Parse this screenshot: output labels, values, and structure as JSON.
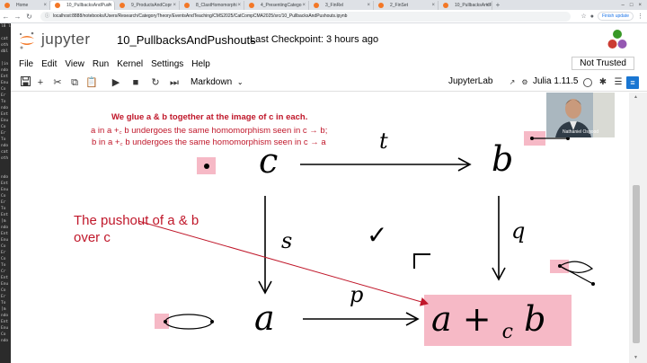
{
  "browser": {
    "tabs": [
      {
        "label": "Home",
        "active": false
      },
      {
        "label": "10_PullbacksAndPush",
        "active": true
      },
      {
        "label": "9_ProductsAndCopr",
        "active": false
      },
      {
        "label": "8_ClastHomomorphi",
        "active": false
      },
      {
        "label": "4_PresentingCatego",
        "active": false
      },
      {
        "label": "3_FinRel",
        "active": false
      },
      {
        "label": "2_FinSet",
        "active": false
      },
      {
        "label": "10_PullbacksAndPus",
        "active": false
      }
    ],
    "url": "localhost:8888/notebooks/Users/Research/CategoryTheory/EventsAndTeaching/CMS2025/CatCompCMA2025/src/10_PullbacksAndPushouts.ipynb",
    "update_label": "Finish update"
  },
  "terminal_lines": [
    "l8 l",
    "",
    "cat",
    "oth",
    "dbl",
    "",
    "[in",
    "ndo",
    "Ent",
    "Enu",
    "Co",
    "Er",
    "To",
    "ndo",
    "Ent",
    "Enu",
    "Co",
    "Er",
    "To",
    "ndo",
    "cat",
    "oth",
    "",
    "",
    "ndo",
    "Ent",
    "Enu",
    "Co",
    "Er",
    "To",
    "Ent",
    "[m",
    "ndo",
    "Ent",
    "Enu",
    "Co",
    "Er",
    "Co",
    "To",
    "Cr",
    "Ent",
    "Enu",
    "Co",
    "Er",
    "To",
    "[m",
    "ndo",
    "Ent",
    "Enu",
    "Co",
    "ndo"
  ],
  "jupyter": {
    "logo_text": "jupyter",
    "notebook_title": "10_PullbacksAndPushouts",
    "checkpoint": "Last Checkpoint: 3 hours ago",
    "menu": [
      "File",
      "Edit",
      "View",
      "Run",
      "Kernel",
      "Settings",
      "Help"
    ],
    "trust_status": "Not Trusted",
    "cell_type": "Markdown",
    "kernel_name": "JupyterLab",
    "kernel_lang": "Julia 1.11.5"
  },
  "notes": {
    "line1": "We glue a & b together at the image of c in each.",
    "line2": "a in a +꜀ b undergoes the same homomorphism seen in c → b;",
    "line3": "b in a +꜀ b undergoes the same homomorphism seen in c → a",
    "pushout_label_1": "The pushout of a & b",
    "pushout_label_2": "over c"
  },
  "diagram": {
    "obj_c": "c",
    "obj_b": "b",
    "obj_a": "a",
    "pushout_main": "a + ",
    "pushout_sub": "c",
    "pushout_b": " b",
    "arrow_t": "t",
    "arrow_s": "s",
    "arrow_q": "q",
    "arrow_p": "p",
    "checkmark": "✓"
  },
  "webcam": {
    "name": "Nathaniel Osgood"
  },
  "colors": {
    "jupyter_orange": "#f37726",
    "annotation_red": "#c0172a",
    "highlight_pink": "#f6b9c6"
  }
}
